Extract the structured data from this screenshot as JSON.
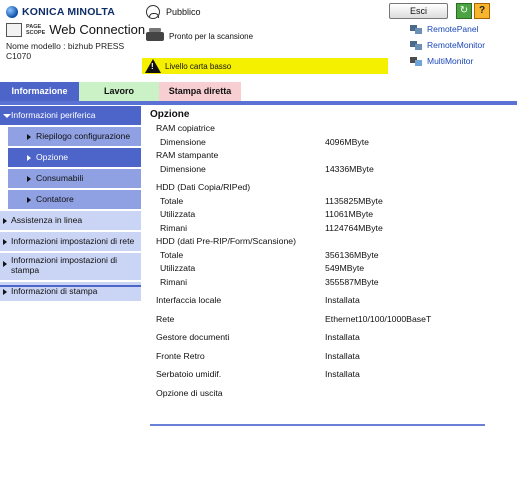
{
  "brand": {
    "konica": "KONICA MINOLTA",
    "pagescope": "PAGE\nSCOPE",
    "web_connection": "Web Connection",
    "model_label": "Nome modello : bizhub PRESS",
    "model_value": "C1070"
  },
  "user": {
    "label": "Pubblico"
  },
  "buttons": {
    "logout": "Esci",
    "refresh": "↻",
    "help": "?"
  },
  "status": {
    "scanner": "Pronto per la scansione",
    "warning": "Livello carta basso"
  },
  "tools": [
    {
      "label": "RemotePanel",
      "icon": "remote-panel-icon"
    },
    {
      "label": "RemoteMonitor",
      "icon": "remote-monitor-icon"
    },
    {
      "label": "MultiMonitor",
      "icon": "multi-monitor-icon"
    }
  ],
  "tabs": {
    "informazione": "Informazione",
    "lavoro": "Lavoro",
    "stampa_diretta": "Stampa diretta"
  },
  "sidebar": {
    "informazioni_periferica": "Informazioni periferica",
    "riepilogo": "Riepilogo configurazione",
    "opzione": "Opzione",
    "consumabili": "Consumabili",
    "contatore": "Contatore",
    "assistenza": "Assistenza in linea",
    "info_impostazioni_rete": "Informazioni impostazioni di rete",
    "info_impostazioni_stampa_1": "Informazioni impostazioni di",
    "info_impostazioni_stampa_2": "stampa",
    "informazioni_stampa": "Informazioni di stampa"
  },
  "content": {
    "title": "Opzione",
    "ram_copiatrice": "RAM copiatrice",
    "ram_stampante": "RAM stampante",
    "dimensione": "Dimensione",
    "ram_copiatrice_value": "4096MByte",
    "ram_stampante_value": "14336MByte",
    "hdd_copia_title": "HDD (Dati Copia/RIPed)",
    "totale": "Totale",
    "utilizzata": "Utilizzata",
    "rimani": "Rimani",
    "hdd_copia_totale": "1135825MByte",
    "hdd_copia_utilizzata": "11061MByte",
    "hdd_copia_rimani": "1124764MByte",
    "hdd_prerip_title": "HDD (dati Pre-RIP/Form/Scansione)",
    "hdd_prerip_totale": "356136MByte",
    "hdd_prerip_utilizzata": "549MByte",
    "hdd_prerip_rimani": "355587MByte",
    "interfaccia_locale": "Interfaccia locale",
    "interfaccia_locale_value": "Installata",
    "rete": "Rete",
    "rete_value": "Ethernet10/100/1000BaseT",
    "gestore_documenti": "Gestore documenti",
    "gestore_documenti_value": "Installata",
    "fronte_retro": "Fronte Retro",
    "fronte_retro_value": "Installata",
    "serbatoio": "Serbatoio umidif.",
    "serbatoio_value": "Installata",
    "opzione_uscita": "Opzione di uscita"
  }
}
